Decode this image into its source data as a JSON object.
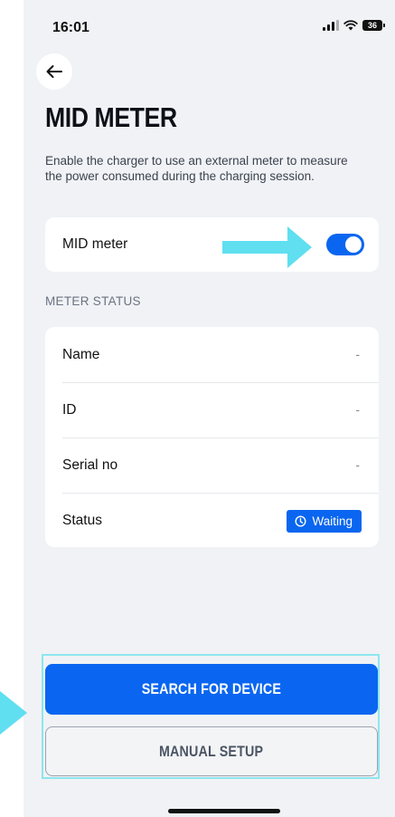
{
  "status_bar": {
    "time": "16:01",
    "battery": "36"
  },
  "header": {
    "back_icon": "arrow-left-icon",
    "title": "MID METER"
  },
  "description": "Enable the charger to use an external meter to measure the power consumed during the charging session.",
  "mid_toggle": {
    "label": "MID meter",
    "enabled": true
  },
  "meter_status": {
    "section_label": "METER STATUS",
    "rows": [
      {
        "label": "Name",
        "value": "-"
      },
      {
        "label": "ID",
        "value": "-"
      },
      {
        "label": "Serial no",
        "value": "-"
      }
    ],
    "status": {
      "label": "Status",
      "badge": "Waiting",
      "badge_icon": "clock-icon"
    }
  },
  "buttons": {
    "search": "SEARCH FOR DEVICE",
    "manual": "MANUAL SETUP"
  },
  "colors": {
    "accent": "#0a66f0",
    "annotation": "#5fdff0",
    "background": "#f0f2f5"
  }
}
